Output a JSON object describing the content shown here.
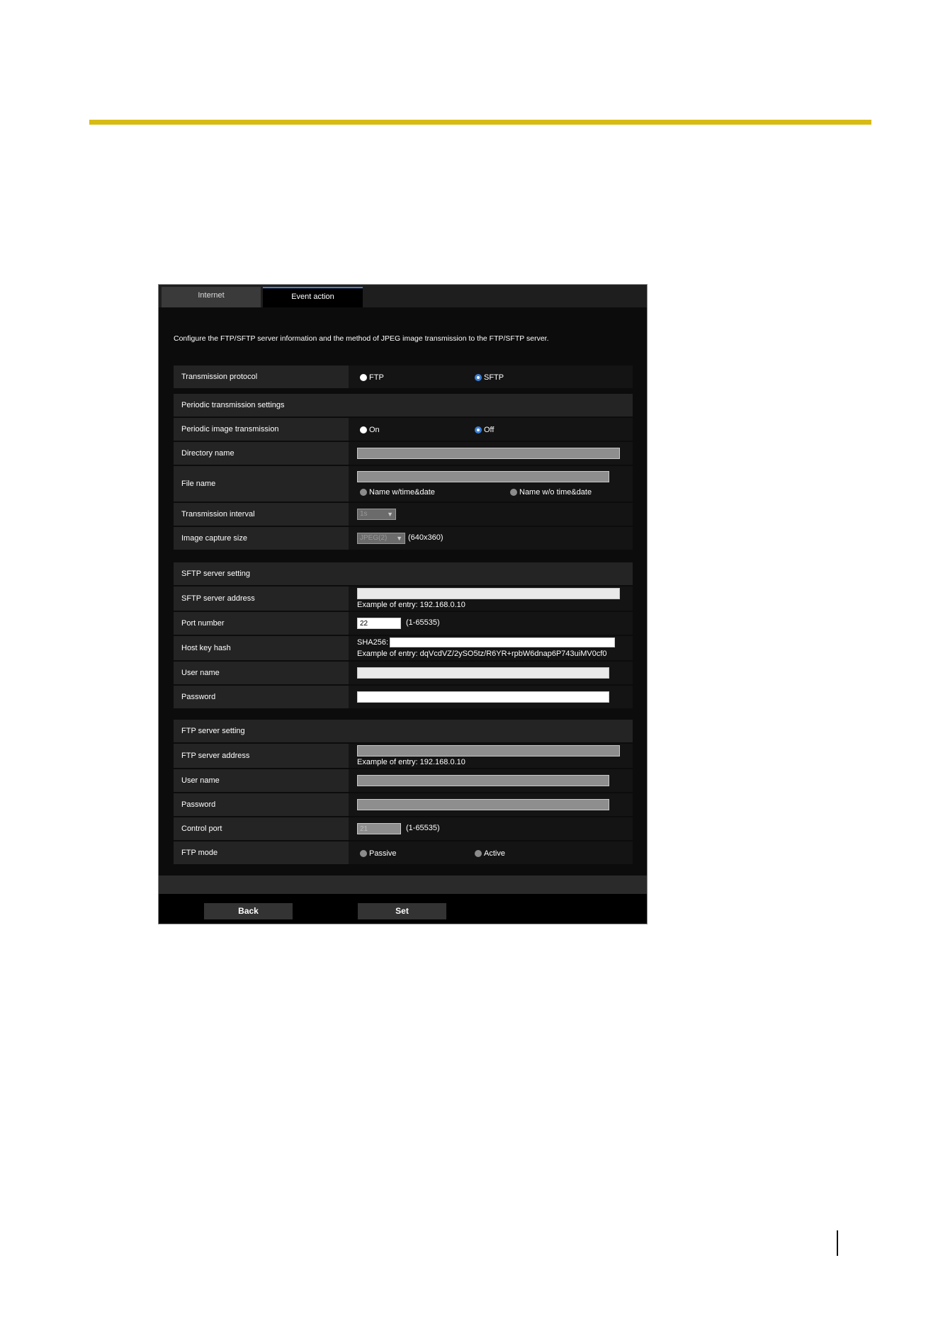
{
  "tabs": [
    "Internet",
    "Event action"
  ],
  "description": "Configure the FTP/SFTP server information and the method of JPEG image transmission to the FTP/SFTP server.",
  "transmission_protocol": {
    "label": "Transmission protocol",
    "options": [
      "FTP",
      "SFTP"
    ],
    "selected": "SFTP"
  },
  "periodic": {
    "section_title": "Periodic transmission settings",
    "image_transmission": {
      "label": "Periodic image transmission",
      "options": [
        "On",
        "Off"
      ],
      "selected": "Off"
    },
    "directory_name": {
      "label": "Directory name",
      "value": ""
    },
    "file_name": {
      "label": "File name",
      "value": "",
      "options": [
        "Name w/time&date",
        "Name w/o time&date"
      ]
    },
    "transmission_interval": {
      "label": "Transmission interval",
      "value": "1s"
    },
    "image_capture_size": {
      "label": "Image capture size",
      "value": "JPEG(2)",
      "resolution": "(640x360)"
    }
  },
  "sftp": {
    "section_title": "SFTP server setting",
    "server_address": {
      "label": "SFTP server address",
      "value": "",
      "example": "Example of entry: 192.168.0.10"
    },
    "port_number": {
      "label": "Port number",
      "value": "22",
      "range": "(1-65535)"
    },
    "host_key_hash": {
      "label": "Host key hash",
      "prefix": "SHA256:",
      "value": "",
      "example": "Example of entry: dqVcdVZ/2ySO5tz/R6YR+rpbW6dnap6P743uiMV0cf0"
    },
    "user_name": {
      "label": "User name",
      "value": ""
    },
    "password": {
      "label": "Password",
      "value": ""
    }
  },
  "ftp": {
    "section_title": "FTP server setting",
    "server_address": {
      "label": "FTP server address",
      "value": "",
      "example": "Example of entry: 192.168.0.10"
    },
    "user_name": {
      "label": "User name",
      "value": ""
    },
    "password": {
      "label": "Password",
      "value": ""
    },
    "control_port": {
      "label": "Control port",
      "value": "21",
      "range": "(1-65535)"
    },
    "mode": {
      "label": "FTP mode",
      "options": [
        "Passive",
        "Active"
      ]
    }
  },
  "buttons": {
    "back": "Back",
    "set": "Set"
  }
}
